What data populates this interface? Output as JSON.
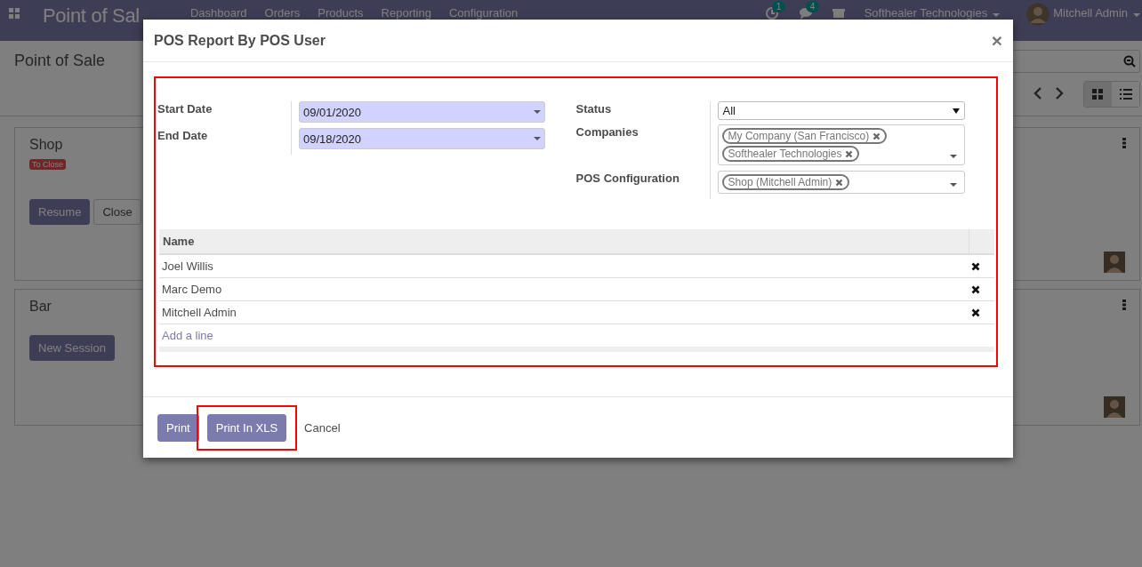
{
  "navbar": {
    "app_title": "Point of Sal",
    "menu": [
      "Dashboard",
      "Orders",
      "Products",
      "Reporting",
      "Configuration"
    ],
    "activity_count": "1",
    "message_count": "4",
    "company": "Softhealer Technologies",
    "user": "Mitchell Admin"
  },
  "control_panel": {
    "breadcrumb": "Point of Sale",
    "views": [
      {
        "kind": "kanban",
        "selected": true
      },
      {
        "kind": "list",
        "selected": false
      }
    ]
  },
  "cards": [
    {
      "title": "Shop",
      "badge": "To Close",
      "buttons": [
        {
          "label": "Resume",
          "kind": "primary"
        },
        {
          "label": "Close",
          "kind": "secondary"
        }
      ]
    },
    {
      "title": "Bar",
      "buttons": [
        {
          "label": "New Session",
          "kind": "primary"
        }
      ]
    }
  ],
  "dialog": {
    "title": "POS Report By POS User",
    "close": "×",
    "left_fields": [
      {
        "label": "Start Date",
        "kind": "date",
        "value": "09/01/2020"
      },
      {
        "label": "End Date",
        "kind": "date",
        "value": "09/18/2020"
      }
    ],
    "right_fields": [
      {
        "label": "Status",
        "kind": "select",
        "value": "All"
      },
      {
        "label": "Companies",
        "kind": "tags",
        "tags": [
          "My Company (San Francisco)",
          "Softhealer Technologies"
        ]
      },
      {
        "label": "POS Configuration",
        "kind": "tags",
        "tags": [
          "Shop (Mitchell Admin)"
        ]
      }
    ],
    "table": {
      "columns": [
        "Name"
      ],
      "rows": [
        {
          "name": "Joel Willis"
        },
        {
          "name": "Marc Demo"
        },
        {
          "name": "Mitchell Admin"
        }
      ],
      "add_line": "Add a line"
    },
    "buttons": [
      {
        "label": "Print",
        "kind": "primary",
        "highlighted": false
      },
      {
        "label": "Print In XLS",
        "kind": "primary",
        "highlighted": true
      },
      {
        "label": "Cancel",
        "kind": "link",
        "highlighted": false
      }
    ]
  }
}
